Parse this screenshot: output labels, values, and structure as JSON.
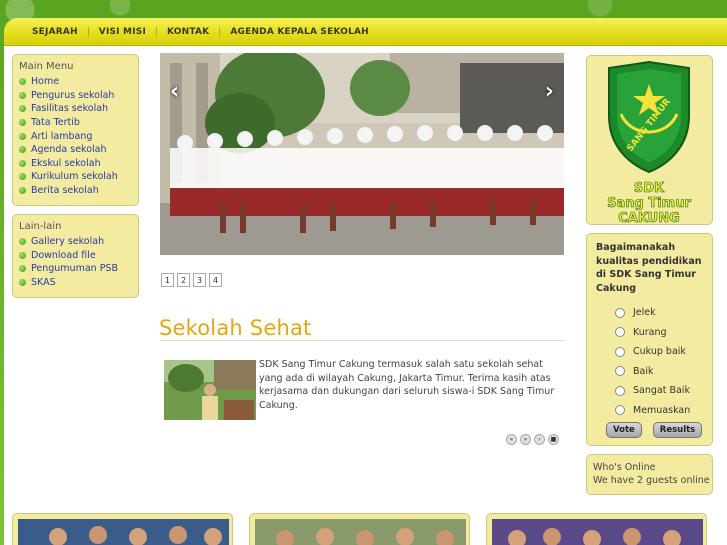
{
  "topnav": {
    "items": [
      "SEJARAH",
      "VISI MISI",
      "KONTAK",
      "AGENDA KEPALA SEKOLAH"
    ]
  },
  "main_menu": {
    "title": "Main Menu",
    "items": [
      "Home",
      "Pengurus sekolah",
      "Fasilitas sekolah",
      "Tata Tertib",
      "Arti lambang",
      "Agenda sekolah",
      "Ekskul sekolah",
      "Kurikulum sekolah",
      "Berita sekolah"
    ]
  },
  "lain_lain": {
    "title": "Lain-lain",
    "items": [
      "Gallery sekolah",
      "Download file",
      "Pengumuman PSB",
      "SKAS"
    ]
  },
  "slideshow": {
    "prev": "‹",
    "next": "›",
    "pages": [
      "1",
      "2",
      "3",
      "4"
    ]
  },
  "article": {
    "title": "Sekolah Sehat",
    "body": "SDK Sang Timur Cakung termasuk salah satu sekolah sehat yang ada di wilayah Cakung, Jakarta Timur. Terima kasih atas kerjasama dan dukungan dari seluruh siswa-i SDK Sang Timur Cakung.",
    "nav": [
      "«",
      "»",
      "›",
      "■"
    ]
  },
  "logo": {
    "shield_text": "SANG TIMUR",
    "line1": "SDK",
    "line2": "Sang Timur",
    "line3": "CAKUNG"
  },
  "poll": {
    "question": "Bagaimanakah kualitas pendidikan di SDK Sang Timur Cakung",
    "options": [
      "Jelek",
      "Kurang",
      "Cukup baik",
      "Baik",
      "Sangat Baik",
      "Memuaskan"
    ],
    "vote_label": "Vote",
    "results_label": "Results"
  },
  "online": {
    "title": "Who's Online",
    "text": "We have 2 guests online"
  },
  "colors": {
    "accent_yellow": "#f3eca0",
    "title_orange": "#e8a60e",
    "link_blue": "#2a3aa0",
    "green_bg": "#6fb52c"
  }
}
